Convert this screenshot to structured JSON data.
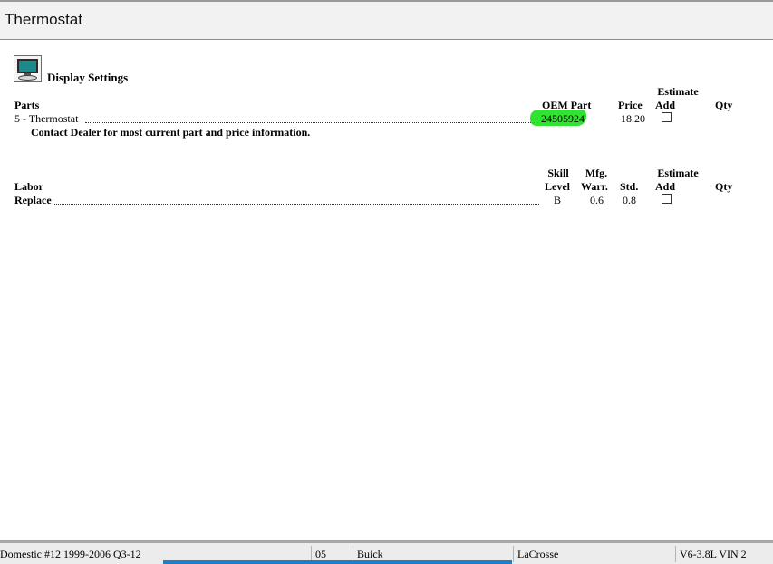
{
  "window": {
    "title": "Thermostat"
  },
  "display_settings": {
    "label": "Display Settings",
    "icon": "monitor-icon"
  },
  "parts": {
    "headers": {
      "parts": "Parts",
      "oem_part": "OEM Part",
      "price": "Price",
      "estimate": "Estimate",
      "add": "Add",
      "qty": "Qty"
    },
    "rows": [
      {
        "name": "5 - Thermostat",
        "oem_part": "24505924",
        "price": "18.20",
        "estimate_add": false
      }
    ],
    "note": "Contact Dealer for most current part and price information."
  },
  "labor": {
    "headers": {
      "labor": "Labor",
      "skill": "Skill",
      "level": "Level",
      "mfg": "Mfg.",
      "warr": "Warr.",
      "std": "Std.",
      "estimate": "Estimate",
      "add": "Add",
      "qty": "Qty"
    },
    "rows": [
      {
        "name": "Replace",
        "skill_level": "B",
        "mfg_warr": "0.6",
        "std": "0.8",
        "estimate_add": false
      }
    ]
  },
  "status_bar": {
    "database": "Domestic #12 1999-2006 Q3-12",
    "year": "05",
    "make": "Buick",
    "model": "LaCrosse",
    "engine": "V6-3.8L VIN 2"
  },
  "colors": {
    "highlight": "#19e019",
    "monitor_screen": "#1a8a8a"
  }
}
